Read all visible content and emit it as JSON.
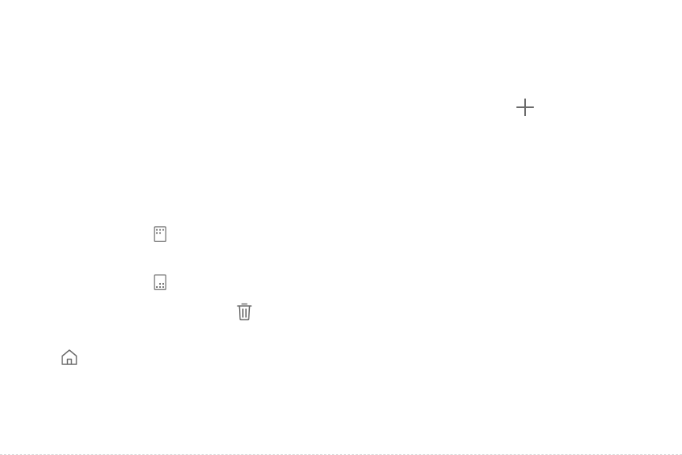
{
  "icons": {
    "add": "plus-icon",
    "apps_top": "grid-apps-top-icon",
    "apps_bottom": "grid-apps-bottom-icon",
    "delete": "trash-icon",
    "home": "home-icon"
  },
  "colors": {
    "icon_stroke": "#6b6b6b",
    "background": "#ffffff"
  }
}
